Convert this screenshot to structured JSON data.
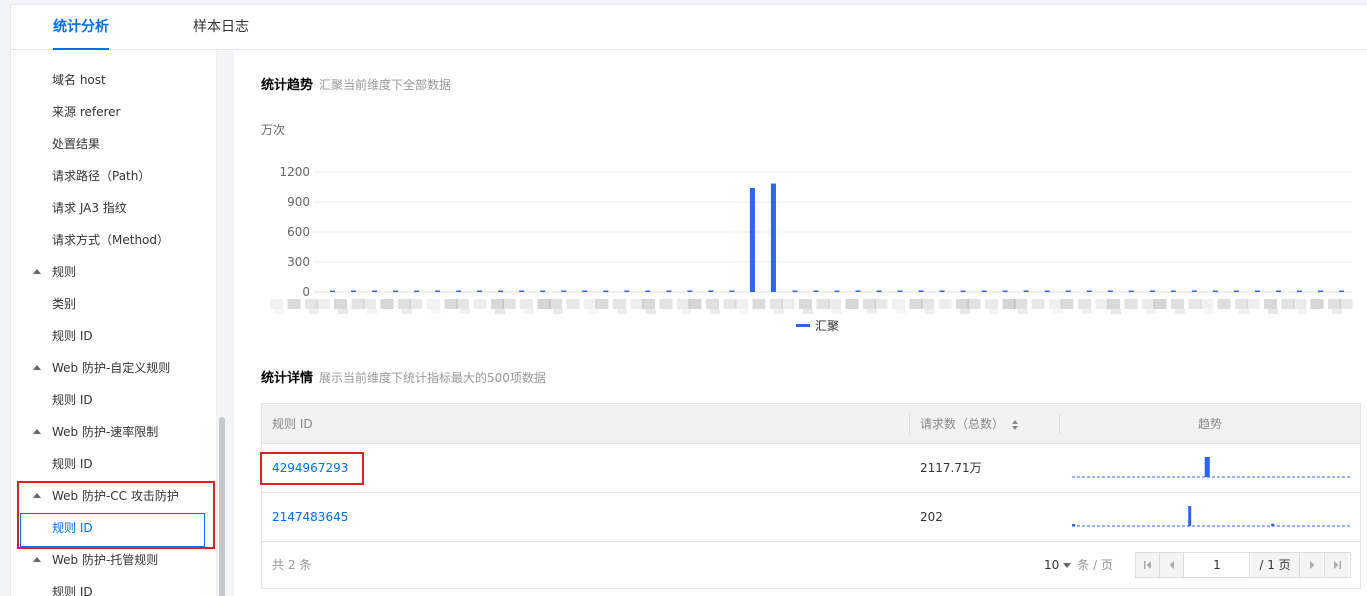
{
  "tabs": [
    {
      "label": "统计分析",
      "active": true
    },
    {
      "label": "样本日志",
      "active": false
    }
  ],
  "sidebar": {
    "items": [
      {
        "label": "域名 host",
        "type": "child"
      },
      {
        "label": "来源 referer",
        "type": "child"
      },
      {
        "label": "处置结果",
        "type": "child"
      },
      {
        "label": "请求路径（Path）",
        "type": "child"
      },
      {
        "label": "请求 JA3 指纹",
        "type": "child"
      },
      {
        "label": "请求方式（Method）",
        "type": "child"
      },
      {
        "label": "规则",
        "type": "group"
      },
      {
        "label": "类别",
        "type": "child"
      },
      {
        "label": "规则 ID",
        "type": "child"
      },
      {
        "label": "Web 防护-自定义规则",
        "type": "group"
      },
      {
        "label": "规则 ID",
        "type": "child"
      },
      {
        "label": "Web 防护-速率限制",
        "type": "group"
      },
      {
        "label": "规则 ID",
        "type": "child"
      },
      {
        "label": "Web 防护-CC 攻击防护",
        "type": "group"
      },
      {
        "label": "规则 ID",
        "type": "child",
        "selected": true
      },
      {
        "label": "Web 防护-托管规则",
        "type": "group"
      },
      {
        "label": "规则 ID",
        "type": "child"
      }
    ]
  },
  "trend": {
    "title": "统计趋势",
    "subtitle": "汇聚当前维度下全部数据",
    "unit": "万次"
  },
  "chart_data": {
    "type": "bar",
    "ylim": [
      0,
      1200
    ],
    "yticks": [
      0,
      300,
      600,
      900,
      1200
    ],
    "legend": "汇聚",
    "legend_position": "bottom",
    "x_tick_labels_obscured": true,
    "series": [
      {
        "name": "汇聚",
        "values": [
          0,
          0,
          0,
          0,
          0,
          0,
          0,
          0,
          0,
          0,
          0,
          0,
          0,
          0,
          0,
          0,
          0,
          0,
          0,
          0,
          1040,
          1085,
          0,
          0,
          0,
          0,
          0,
          0,
          0,
          0,
          0,
          0,
          0,
          0,
          0,
          0,
          0,
          0,
          0,
          0,
          0,
          0,
          0,
          0,
          0,
          0,
          0,
          0,
          0
        ]
      }
    ],
    "color": "#2d64f5"
  },
  "detail": {
    "title": "统计详情",
    "subtitle": "展示当前维度下统计指标最大的500项数据",
    "columns": [
      "规则 ID",
      "请求数（总数）",
      "趋势"
    ],
    "rows": [
      {
        "id": "4294967293",
        "count": "2117.71万",
        "spark": [
          0,
          0,
          0,
          0,
          0,
          0,
          0,
          0,
          0,
          0,
          0,
          0,
          0,
          0,
          0,
          0,
          0,
          0,
          0,
          0,
          0,
          0,
          0,
          0,
          0,
          0,
          0,
          0,
          0,
          0,
          0,
          0,
          0,
          0,
          0,
          0,
          0,
          0,
          0,
          0,
          0,
          0,
          0,
          0,
          0,
          0,
          0,
          0,
          0,
          0,
          0,
          0,
          0,
          0,
          0,
          0,
          0,
          0,
          0,
          0,
          0,
          0,
          0,
          1,
          1,
          0,
          0,
          0,
          0,
          0,
          0,
          0,
          0,
          0,
          0,
          0,
          0,
          0,
          0,
          0,
          0,
          0,
          0,
          0,
          0,
          0,
          0,
          0,
          0,
          0,
          0,
          0,
          0,
          0,
          0,
          0,
          0,
          0,
          0,
          0,
          0,
          0,
          0,
          0,
          0,
          0,
          0,
          0,
          0,
          0,
          0,
          0,
          0,
          0,
          0,
          0,
          0,
          0,
          0,
          0,
          0,
          0,
          0,
          0,
          0,
          0,
          0,
          0,
          0,
          0,
          0,
          0
        ]
      },
      {
        "id": "2147483645",
        "count": "202",
        "spark": [
          0.1,
          0,
          0,
          0,
          0,
          0,
          0,
          0,
          0,
          0,
          0,
          0,
          0,
          0,
          0,
          0,
          0,
          0,
          0,
          0,
          0,
          0,
          0,
          0,
          0,
          0,
          0,
          0,
          0,
          0,
          0,
          0,
          0,
          0,
          0,
          0,
          0,
          0,
          0,
          0,
          0,
          0,
          0,
          0,
          0,
          0,
          0,
          0,
          0,
          0,
          0,
          0,
          0,
          0,
          0,
          0,
          1,
          0,
          0,
          0,
          0,
          0,
          0,
          0,
          0,
          0,
          0,
          0,
          0,
          0,
          0,
          0,
          0,
          0,
          0,
          0,
          0,
          0,
          0,
          0,
          0,
          0,
          0,
          0,
          0,
          0,
          0,
          0,
          0,
          0,
          0,
          0,
          0,
          0,
          0,
          0,
          0.12,
          0,
          0,
          0,
          0,
          0,
          0,
          0,
          0,
          0,
          0,
          0,
          0,
          0,
          0,
          0,
          0,
          0,
          0,
          0,
          0,
          0,
          0,
          0,
          0,
          0,
          0,
          0,
          0,
          0,
          0,
          0,
          0,
          0,
          0,
          0,
          0,
          0
        ]
      }
    ],
    "total": "共 2 条",
    "page_size": "10",
    "page_size_unit": "条 / 页",
    "page": "1",
    "pages": "/ 1 页"
  }
}
